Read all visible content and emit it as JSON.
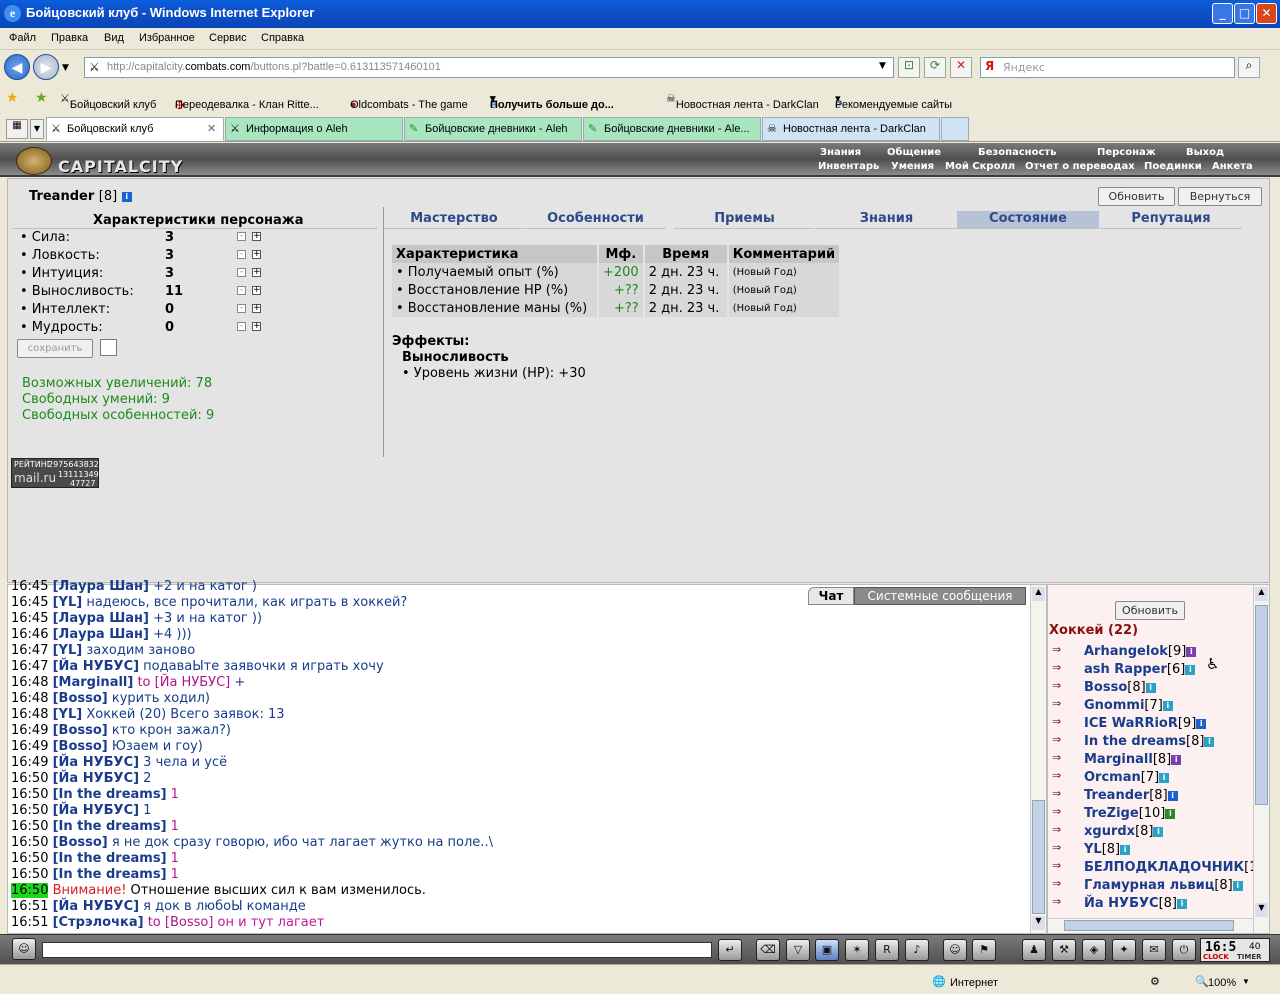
{
  "window": {
    "title": "Бойцовский клуб - Windows Internet Explorer"
  },
  "menu": [
    "Файл",
    "Правка",
    "Вид",
    "Избранное",
    "Сервис",
    "Справка"
  ],
  "address": {
    "prefix": "http://capitalcity.",
    "domain": "combats.com",
    "path": "/buttons.pl?battle=0.613113571460101"
  },
  "search": {
    "placeholder": "Яндекс"
  },
  "favorites": [
    "Бойцовский клуб",
    "Переодевалка - Клан Ritte...",
    "Oldcombats - The game",
    "Получить больше до...",
    "Новостная лента - DarkClan",
    "Рекомендуемые сайты"
  ],
  "tabs": [
    "Бойцовский клуб",
    "Информация о Aleh",
    "Бойцовские дневники - Aleh",
    "Бойцовские дневники - Ale...",
    "Новостная лента - DarkClan"
  ],
  "game": {
    "logo": "CAPITALCITY",
    "nav1": [
      "Знания",
      "Общение",
      "Безопасность",
      "Персонаж",
      "Выход"
    ],
    "nav2": [
      "Инвентарь",
      "Умения",
      "Мой Скролл",
      "Отчет о переводах",
      "Поединки",
      "Анкета"
    ]
  },
  "character": {
    "name": "Treander",
    "level": "[8]",
    "refresh": "Обновить",
    "back": "Вернуться",
    "header": "Характеристики персонажа",
    "stats": [
      {
        "label": "• Сила:",
        "value": "3"
      },
      {
        "label": "• Ловкость:",
        "value": "3"
      },
      {
        "label": "• Интуиция:",
        "value": "3"
      },
      {
        "label": "• Выносливость:",
        "value": "11"
      },
      {
        "label": "• Интеллект:",
        "value": "0"
      },
      {
        "label": "• Мудрость:",
        "value": "0"
      }
    ],
    "save": "сохранить",
    "increases": "Возможных увеличений: 78",
    "skills": "Свободных умений: 9",
    "features": "Свободных особенностей: 9",
    "counter": {
      "label": "РЕЙТИНГ",
      "total": "2975643832",
      "brand": "mail.ru",
      "today": "13111349",
      "hosts": "47727"
    }
  },
  "mainTabs": [
    "Мастерство",
    "Особенности",
    "Приемы",
    "Знания",
    "Состояние",
    "Репутация"
  ],
  "stateTable": {
    "headers": [
      "Характеристика",
      "Мф.",
      "Время",
      "Комментарий"
    ],
    "rows": [
      {
        "name": "• Получаемый опыт (%)",
        "mf": "+200",
        "time": "2 дн. 23 ч.",
        "comment": "(Новый Год)"
      },
      {
        "name": "• Восстановление HP (%)",
        "mf": "+??",
        "time": "2 дн. 23 ч.",
        "comment": "(Новый Год)"
      },
      {
        "name": "• Восстановление маны (%)",
        "mf": "+??",
        "time": "2 дн. 23 ч.",
        "comment": "(Новый Год)"
      }
    ]
  },
  "effects": {
    "title": "Эффекты:",
    "name": "Выносливость",
    "line": "• Уровень жизни (HP): +30"
  },
  "chatTabs": [
    "Чат",
    "Системные сообщения"
  ],
  "chat": [
    {
      "t": "16:45",
      "n": "[Лаура Шан]",
      "m": " +2 и на катог )"
    },
    {
      "t": "16:45",
      "n": "[YL]",
      "m": " надеюсь, все прочитали, как играть в хоккей?"
    },
    {
      "t": "16:45",
      "n": "[Лаура Шан]",
      "m": " +3 и на катог ))"
    },
    {
      "t": "16:46",
      "n": "[Лаура Шан]",
      "m": " +4 )))"
    },
    {
      "t": "16:47",
      "n": "[YL]",
      "m": " заходим заново"
    },
    {
      "t": "16:47",
      "n": "[Йа НУБУС]",
      "m": " подаваЫте заявочки я играть хочу"
    },
    {
      "t": "16:48",
      "n": "[Marginall]",
      "to": " to [Йа НУБУС]",
      "m": " +"
    },
    {
      "t": "16:48",
      "n": "[Bosso]",
      "m": " курить ходил)"
    },
    {
      "t": "16:48",
      "n": "[YL]",
      "m": " Хоккей (20) Всего заявок: 13"
    },
    {
      "t": "16:49",
      "n": "[Bosso]",
      "m": " кто крон зажал?)"
    },
    {
      "t": "16:49",
      "n": "[Bosso]",
      "m": " Юзаем и гоу)"
    },
    {
      "t": "16:49",
      "n": "[Йа НУБУС]",
      "m": " 3 чела и усё"
    },
    {
      "t": "16:50",
      "n": "[Йа НУБУС]",
      "m": " 2"
    },
    {
      "t": "16:50",
      "n": "[In the dreams]",
      "p": " 1"
    },
    {
      "t": "16:50",
      "n": "[Йа НУБУС]",
      "m": " 1"
    },
    {
      "t": "16:50",
      "n": "[In the dreams]",
      "p": " 1"
    },
    {
      "t": "16:50",
      "n": "[Bosso]",
      "m": " я не док сразу говорю, ибо чат лагает жутко на поле..\\"
    },
    {
      "t": "16:50",
      "n": "[In the dreams]",
      "p": " 1"
    },
    {
      "t": "16:50",
      "n": "[In the dreams]",
      "p": " 1"
    },
    {
      "t": "16:50",
      "sys": "Внимание!",
      "m": " Отношение высших сил к вам изменилось."
    },
    {
      "t": "16:51",
      "n": "[Йа НУБУС]",
      "m": " я док в любоЫ команде"
    },
    {
      "t": "16:51",
      "n": "[Стрэлочка]",
      "to": " to [Bosso]",
      "p": " он и тут лагает"
    }
  ],
  "users": {
    "refresh": "Обновить",
    "title": "Хоккей (22)",
    "list": [
      {
        "name": "Arhangelok",
        "lv": "[9]",
        "i": "pu"
      },
      {
        "name": "ash Rapper",
        "lv": "[6]",
        "i": "cy"
      },
      {
        "name": "Bosso",
        "lv": "[8]",
        "i": "cy"
      },
      {
        "name": "Gnommi",
        "lv": "[7]",
        "i": "cy"
      },
      {
        "name": "ICE WaRRioR",
        "lv": "[9]",
        "i": "bl"
      },
      {
        "name": "In the dreams",
        "lv": "[8]",
        "i": "cy"
      },
      {
        "name": "Marginall",
        "lv": "[8]",
        "i": "pu"
      },
      {
        "name": "Orcman",
        "lv": "[7]",
        "i": "cy"
      },
      {
        "name": "Treander",
        "lv": "[8]",
        "i": "bl"
      },
      {
        "name": "TreZige",
        "lv": "[10]",
        "i": "gr"
      },
      {
        "name": "xgurdx",
        "lv": "[8]",
        "i": "cy"
      },
      {
        "name": "YL",
        "lv": "[8]",
        "i": "cy"
      },
      {
        "name": "БЕЛПОДКЛАДОЧНИК",
        "lv": "[1",
        "i": ""
      },
      {
        "name": "Гламурная львиц",
        "lv": "[8]",
        "i": "cy"
      },
      {
        "name": "Йа НУБУС",
        "lv": "[8]",
        "i": "cy"
      }
    ]
  },
  "clock": {
    "time": "16:5",
    "sec": "40",
    "c1": "CLOCK",
    "c2": "TIMER"
  },
  "status": {
    "zone": "Интернет",
    "zoom": "100%"
  }
}
